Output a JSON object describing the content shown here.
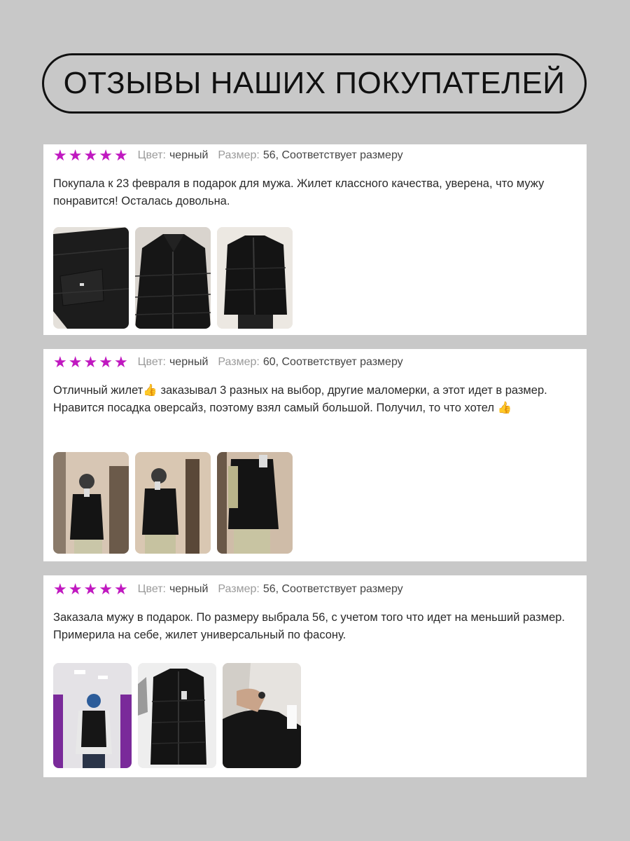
{
  "header": {
    "title": "ОТЗЫВЫ НАШИХ ПОКУПАТЕЛЕЙ"
  },
  "labels": {
    "color_label": "Цвет:",
    "size_label": "Размер:"
  },
  "reviews": [
    {
      "rating": 5,
      "color": "черный",
      "size": "56, Соответствует размеру",
      "text": "Покупала к 23 февраля в подарок для мужа. Жилет классного качества, уверена, что мужу понравится! Осталась довольна.",
      "photos": [
        "vest-closeup-photo",
        "vest-front-photo",
        "vest-worn-photo"
      ]
    },
    {
      "rating": 5,
      "color": "черный",
      "size": "60, Соответствует размеру",
      "text": "Отличный жилет👍 заказывал 3 разных на выбор, другие маломерки, а этот идет в размер. Нравится посадка оверсайз, поэтому взял самый большой. Получил, то что хотел 👍",
      "photos": [
        "mirror-selfie-photo",
        "mirror-selfie-side-photo",
        "mirror-selfie-close-photo"
      ]
    },
    {
      "rating": 5,
      "color": "черный",
      "size": "56, Соответствует размеру",
      "text": "Заказала мужу в подарок. По размеру выбрала 56, с учетом того что идет на меньший размер. Примерила на себе, жилет универсальный по фасону.",
      "photos": [
        "fitting-room-photo",
        "vest-hanging-photo",
        "vest-detail-photo"
      ]
    }
  ],
  "colors": {
    "star": "#c018c0",
    "background": "#c8c8c8",
    "card": "#ffffff"
  }
}
